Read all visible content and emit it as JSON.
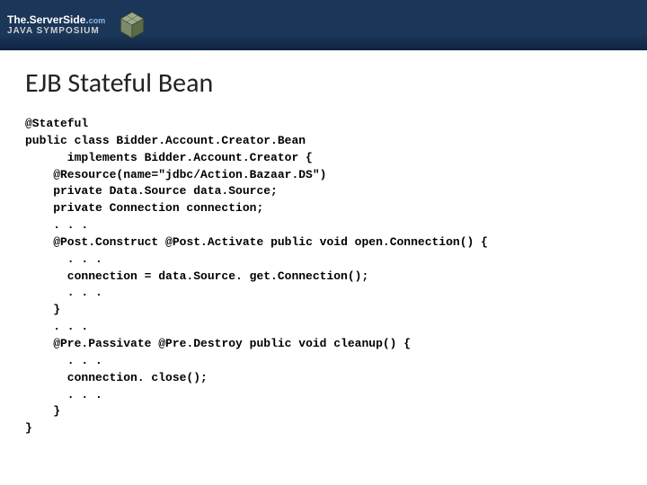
{
  "header": {
    "brand_top_prefix": "The.",
    "brand_top_main": "Server",
    "brand_top_suffix": "Side",
    "brand_top_dot": ".",
    "brand_top_com": "com",
    "brand_bottom": "JAVA SYMPOSIUM"
  },
  "slide": {
    "title": "EJB Stateful Bean"
  },
  "code": {
    "l01": "@Stateful",
    "l02": "public class Bidder.Account.Creator.Bean",
    "l03": "      implements Bidder.Account.Creator {",
    "l04": "    @Resource(name=\"jdbc/Action.Bazaar.DS\")",
    "l05": "    private Data.Source data.Source;",
    "l06": "    private Connection connection;",
    "l07": "    . . .",
    "l08a": "    @Post.Construct",
    "l08b": " @Post.Activate",
    "l08c": " public void open.Connection() {",
    "l09": "      . . .",
    "l10": "      connection = data.Source. get.Connection();",
    "l11": "      . . .",
    "l12": "    }",
    "l13": "    . . .",
    "l14a": "    @Pre.Passivate",
    "l14b": " @Pre.Destroy",
    "l14c": " public void cleanup() {",
    "l15": "      . . .",
    "l16": "      connection. close();",
    "l17": "      . . .",
    "l18": "    }",
    "l19": "}"
  }
}
